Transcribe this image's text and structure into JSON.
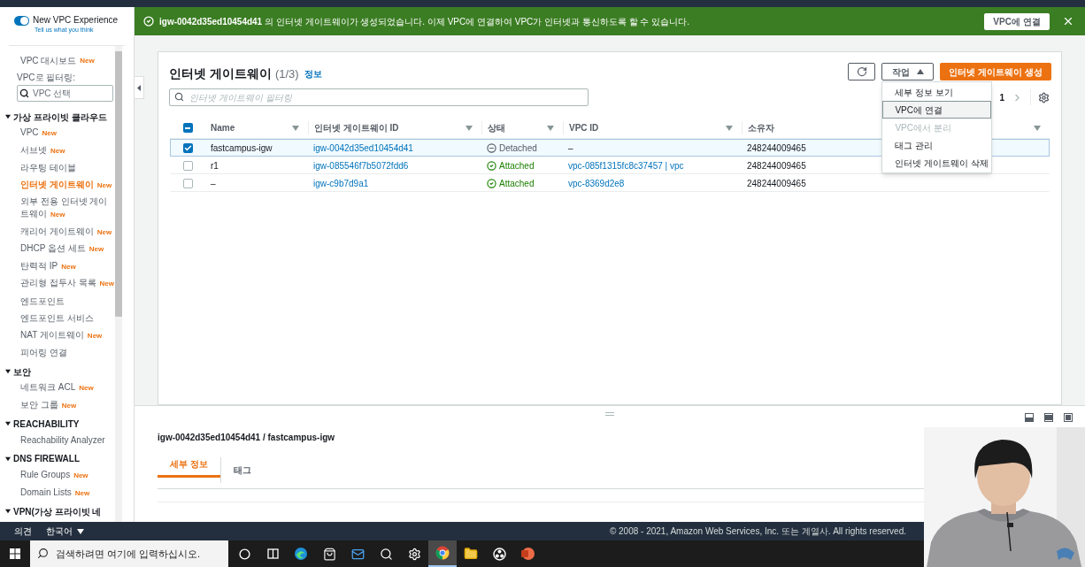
{
  "sidebar": {
    "toggle": {
      "label": "New VPC Experience",
      "link": "Tell us what you think",
      "on": true
    },
    "dashboard": {
      "label": "VPC 대시보드",
      "badge": "New"
    },
    "filter": {
      "label": "VPC로 필터링:",
      "placeholder": "VPC 선택"
    },
    "sections": [
      {
        "title": "가상 프라이빗 클라우드",
        "expanded": true,
        "items": [
          {
            "label": "VPC",
            "badge": "New",
            "selected": false
          },
          {
            "label": "서브넷",
            "badge": "New",
            "selected": false
          },
          {
            "label": "라우팅 테이블",
            "selected": false
          },
          {
            "label": "인터넷 게이트웨이",
            "badge": "New",
            "selected": true
          },
          {
            "label": "외부 전용 인터넷 게이트웨이",
            "badge": "New",
            "selected": false
          },
          {
            "label": "캐리어 게이트웨이",
            "badge": "New",
            "selected": false
          },
          {
            "label": "DHCP 옵션 세트",
            "badge": "New",
            "selected": false
          },
          {
            "label": "탄력적 IP",
            "badge": "New",
            "selected": false
          },
          {
            "label": "관리형 접두사 목록",
            "badge": "New",
            "selected": false
          },
          {
            "label": "엔드포인트",
            "selected": false
          },
          {
            "label": "엔드포인트 서비스",
            "selected": false
          },
          {
            "label": "NAT 게이트웨이",
            "badge": "New",
            "selected": false
          },
          {
            "label": "피어링 연결",
            "selected": false
          }
        ]
      },
      {
        "title": "보안",
        "expanded": true,
        "items": [
          {
            "label": "네트워크 ACL",
            "badge": "New",
            "selected": false
          },
          {
            "label": "보안 그룹",
            "badge": "New",
            "selected": false
          }
        ]
      },
      {
        "title": "REACHABILITY",
        "expanded": true,
        "items": [
          {
            "label": "Reachability Analyzer",
            "selected": false
          }
        ]
      },
      {
        "title": "DNS FIREWALL",
        "expanded": true,
        "items": [
          {
            "label": "Rule Groups",
            "badge": "New",
            "selected": false
          },
          {
            "label": "Domain Lists",
            "badge": "New",
            "selected": false
          }
        ]
      },
      {
        "title": "VPN(가상 프라이빗 네",
        "expanded": true
      }
    ]
  },
  "banner": {
    "message": "**igw-0042d35ed10454d41** 의 인터넷 게이트웨이가 생성되었습니다. 이제 VPC에 연결하여 VPC가 인터넷과 통신하도록 할 수 있습니다.",
    "button": "VPC에 연결"
  },
  "panel": {
    "title": "인터넷 게이트웨이",
    "count": "(1/3)",
    "info": "정보",
    "search_placeholder": "인터넷 게이트웨이 필터링",
    "actions_button": "작업",
    "actions_open": true,
    "create_button": "인터넷 게이트웨이 생성",
    "page": "1",
    "menu": [
      {
        "label": "세부 정보 보기",
        "disabled": false,
        "highlighted": false
      },
      {
        "label": "VPC에 연결",
        "disabled": false,
        "highlighted": true
      },
      {
        "label": "VPC에서 분리",
        "disabled": true,
        "highlighted": false
      },
      {
        "label": "태그 관리",
        "disabled": false,
        "highlighted": false
      },
      {
        "label": "인터넷 게이트웨이 삭제",
        "disabled": false,
        "highlighted": false
      }
    ]
  },
  "table": {
    "select_all": {
      "indeterminate": true
    },
    "columns": [
      "Name",
      "인터넷 게이트웨이 ID",
      "상태",
      "VPC ID",
      "소유자"
    ],
    "rows": [
      {
        "selected": true,
        "name": "fastcampus-igw",
        "id": "igw-0042d35ed10454d41",
        "state": {
          "kind": "detached",
          "text": "Detached"
        },
        "vpc": "–",
        "vpc_link": false,
        "owner": "248244009465"
      },
      {
        "selected": false,
        "name": "r1",
        "id": "igw-085546f7b5072fdd6",
        "state": {
          "kind": "attached",
          "text": "Attached"
        },
        "vpc": "vpc-085f1315fc8c37457 | vpc",
        "vpc_link": true,
        "owner": "248244009465"
      },
      {
        "selected": false,
        "name": "–",
        "id": "igw-c9b7d9a1",
        "state": {
          "kind": "attached",
          "text": "Attached"
        },
        "vpc": "vpc-8369d2e8",
        "vpc_link": true,
        "owner": "248244009465"
      }
    ]
  },
  "details": {
    "title": "igw-0042d35ed10454d41 / fastcampus-igw",
    "tabs": [
      {
        "label": "세부 정보",
        "selected": true
      },
      {
        "label": "태그",
        "selected": false
      }
    ]
  },
  "footer": {
    "feedback": "의견",
    "language": "한국어",
    "copyright": "© 2008 - 2021, Amazon Web Services, Inc. 또는 계열사. All rights reserved."
  },
  "taskbar": {
    "search_placeholder": "검색하려면 여기에 입력하십시오.",
    "apps": [
      {
        "kind": "cortana",
        "selected": false
      },
      {
        "kind": "taskview",
        "selected": false
      },
      {
        "kind": "edge",
        "selected": false
      },
      {
        "kind": "store",
        "selected": false
      },
      {
        "kind": "mail",
        "selected": false
      },
      {
        "kind": "magnifier",
        "selected": false
      },
      {
        "kind": "settings",
        "selected": false
      },
      {
        "kind": "chrome",
        "selected": true
      },
      {
        "kind": "folder",
        "selected": false
      },
      {
        "kind": "obs",
        "selected": false
      },
      {
        "kind": "powerpoint",
        "selected": false
      }
    ]
  }
}
